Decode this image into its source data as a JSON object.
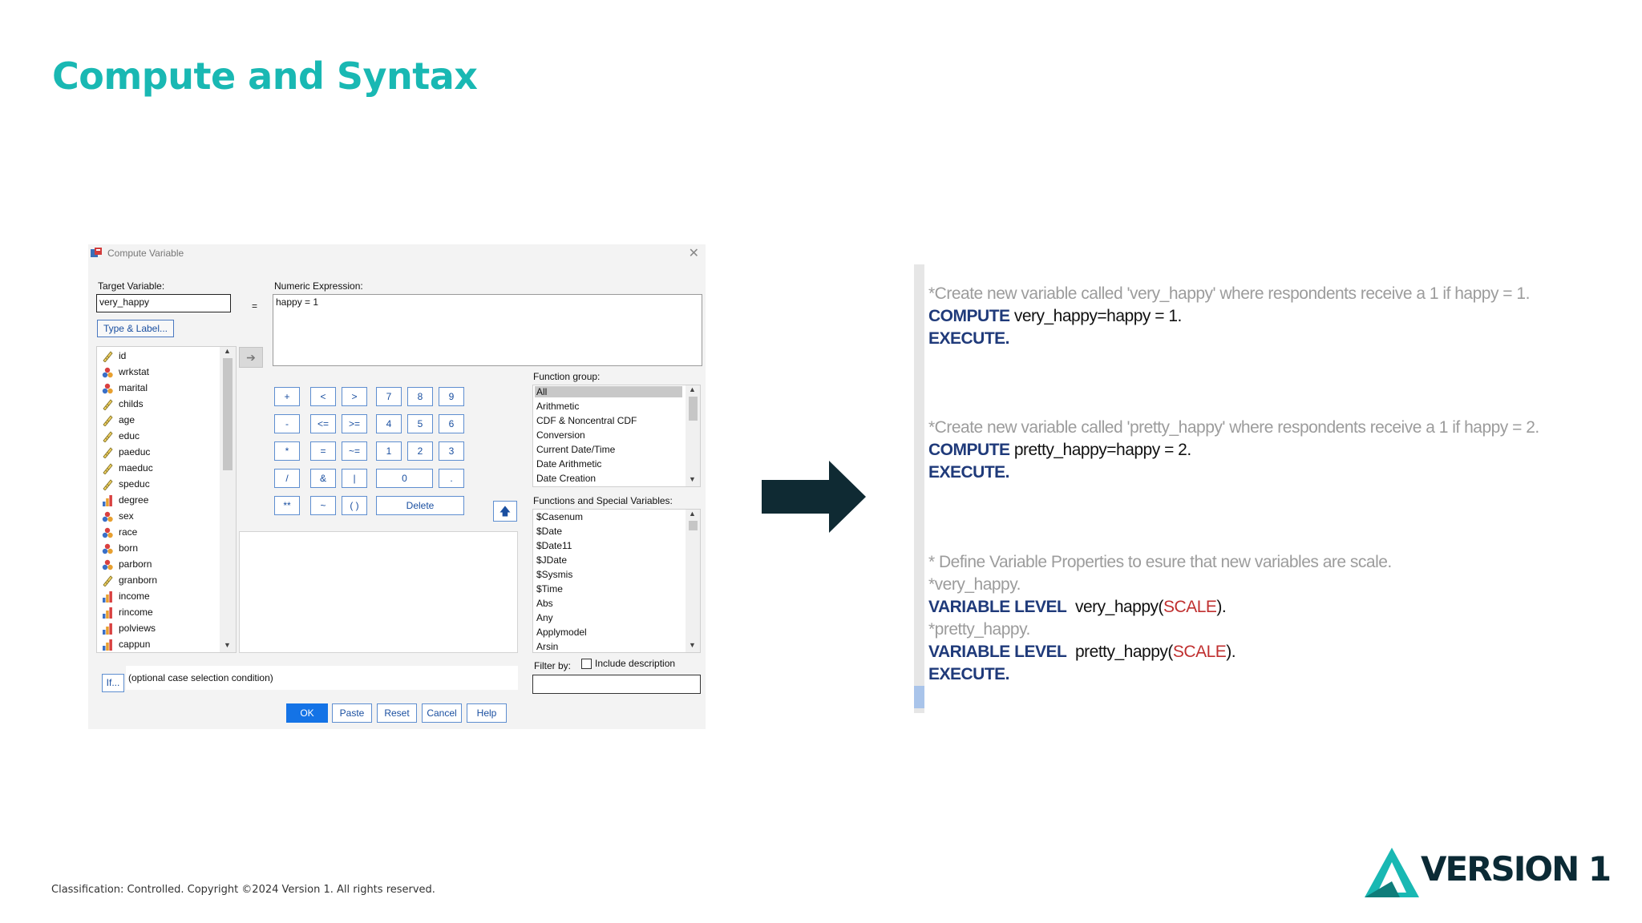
{
  "slide": {
    "title": "Compute and Syntax",
    "footer": "Classification: Controlled. Copyright ©2024 Version 1. All rights reserved.",
    "logo_text": "VERSION 1",
    "brand_color": "#19b8b3"
  },
  "dialog": {
    "title": "Compute Variable",
    "target_label": "Target Variable:",
    "target_value": "very_happy",
    "type_label_button": "Type & Label...",
    "equals": "=",
    "expression_label": "Numeric Expression:",
    "expression_value": "happy = 1",
    "variables": [
      {
        "name": "id",
        "icon": "ruler-icon"
      },
      {
        "name": "wrkstat",
        "icon": "nominal-icon"
      },
      {
        "name": "marital",
        "icon": "nominal-icon"
      },
      {
        "name": "childs",
        "icon": "ruler-icon"
      },
      {
        "name": "age",
        "icon": "ruler-icon"
      },
      {
        "name": "educ",
        "icon": "ruler-icon"
      },
      {
        "name": "paeduc",
        "icon": "ruler-icon"
      },
      {
        "name": "maeduc",
        "icon": "ruler-icon"
      },
      {
        "name": "speduc",
        "icon": "ruler-icon"
      },
      {
        "name": "degree",
        "icon": "ordinal-icon"
      },
      {
        "name": "sex",
        "icon": "nominal-icon"
      },
      {
        "name": "race",
        "icon": "nominal-icon"
      },
      {
        "name": "born",
        "icon": "nominal-icon"
      },
      {
        "name": "parborn",
        "icon": "nominal-icon"
      },
      {
        "name": "granborn",
        "icon": "ruler-icon"
      },
      {
        "name": "income",
        "icon": "ordinal-icon"
      },
      {
        "name": "rincome",
        "icon": "ordinal-icon"
      },
      {
        "name": "polviews",
        "icon": "ordinal-icon"
      },
      {
        "name": "cappun",
        "icon": "ordinal-icon"
      }
    ],
    "keypad": {
      "row1": [
        "+",
        "<",
        ">",
        "7",
        "8",
        "9"
      ],
      "row2": [
        "-",
        "<=",
        ">=",
        "4",
        "5",
        "6"
      ],
      "row3": [
        "*",
        "=",
        "~=",
        "1",
        "2",
        "3"
      ],
      "row4": [
        "/",
        "&",
        "|",
        "0",
        "."
      ],
      "row5": [
        "**",
        "~",
        "( )",
        "Delete"
      ]
    },
    "function_group_label": "Function group:",
    "function_groups": [
      "All",
      "Arithmetic",
      "CDF & Noncentral CDF",
      "Conversion",
      "Current Date/Time",
      "Date Arithmetic",
      "Date Creation"
    ],
    "functions_label": "Functions and Special Variables:",
    "functions": [
      "$Casenum",
      "$Date",
      "$Date11",
      "$JDate",
      "$Sysmis",
      "$Time",
      "Abs",
      "Any",
      "Applymodel",
      "Arsin"
    ],
    "if_button": "If...",
    "condition_text": "(optional case selection condition)",
    "filter_label": "Filter by:",
    "include_description": "Include description",
    "buttons": {
      "ok": "OK",
      "paste": "Paste",
      "reset": "Reset",
      "cancel": "Cancel",
      "help": "Help"
    }
  },
  "syntax": {
    "lines": [
      {
        "kind": "comment",
        "text": "*Create new variable called 'very_happy' where respondents receive a 1 if happy = 1."
      },
      {
        "kind": "command",
        "kw": "COMPUTE",
        "rest": " very_happy=happy = 1."
      },
      {
        "kind": "keyword",
        "kw": "EXECUTE."
      },
      {
        "kind": "comment",
        "text": "*Create new variable called 'pretty_happy' where respondents receive a 1 if happy = 2."
      },
      {
        "kind": "command",
        "kw": "COMPUTE",
        "rest": " pretty_happy=happy = 2."
      },
      {
        "kind": "keyword",
        "kw": "EXECUTE."
      },
      {
        "kind": "comment",
        "text": "* Define Variable Properties to esure that new variables are scale."
      },
      {
        "kind": "comment",
        "text": "*very_happy."
      },
      {
        "kind": "level",
        "kw": "VARIABLE LEVEL",
        "var": "  very_happy(",
        "level": "SCALE",
        "end": ")."
      },
      {
        "kind": "comment",
        "text": "*pretty_happy."
      },
      {
        "kind": "level",
        "kw": "VARIABLE LEVEL",
        "var": "  pretty_happy(",
        "level": "SCALE",
        "end": ")."
      },
      {
        "kind": "keyword",
        "kw": "EXECUTE."
      }
    ]
  }
}
